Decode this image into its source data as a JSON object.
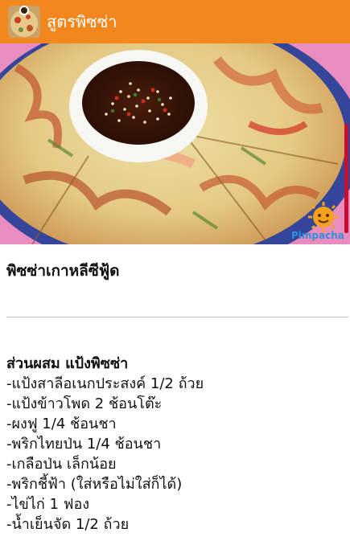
{
  "app_bar": {
    "title": "สูตรพิซซ่า",
    "icon": "pizza-thumbnail-icon",
    "background_color": "#f2871e"
  },
  "hero": {
    "watermark": "Pimpacha",
    "watermark_icon": "sun-mascot-icon"
  },
  "recipe": {
    "title": "พิซซ่าเกาหลีซีฟู้ด",
    "section_header": "ส่วนผสม แป้งพิซซ่า",
    "ingredients": [
      "-แป้งสาลีอเนกประสงค์ 1/2 ถ้วย",
      "-แป้งข้าวโพด 2 ช้อนโต๊ะ",
      "-ผงฟู 1/4 ช้อนชา",
      "-พริกไทยป่น 1/4 ช้อนชา",
      "-เกลือป่น เล็กน้อย",
      "-พริกชี้ฟ้า (ใส่หรือไม่ใส่ก็ได้)",
      "-ไข่ไก่ 1 ฟอง",
      "-น้ำเย็นจัด 1/2 ถ้วย"
    ]
  },
  "colors": {
    "scrollbar": "#c8102e",
    "divider": "#bdbdbd"
  }
}
